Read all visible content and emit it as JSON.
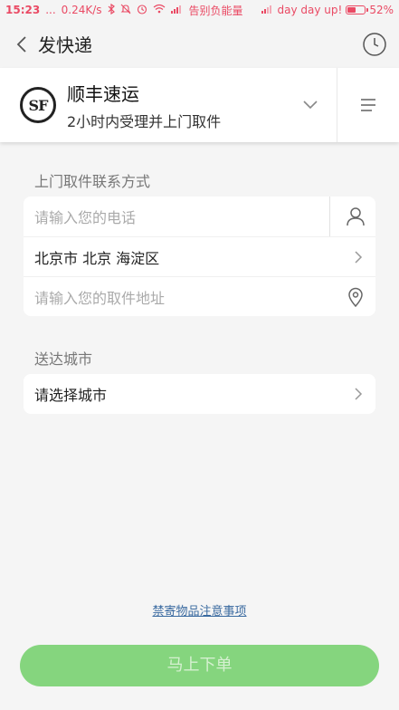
{
  "status_bar": {
    "time": "15:23",
    "dots": "...",
    "speed": "0.24K/s",
    "carrier1": "告别负能量",
    "carrier2": "day day up!",
    "battery": "52%",
    "battery_level": 0.52,
    "accent_color": "#ea4a64"
  },
  "header": {
    "title": "发快递",
    "back_icon": "chevron-left-icon",
    "history_icon": "clock-icon"
  },
  "courier": {
    "logo_text": "SF",
    "name": "顺丰速运",
    "subtitle": "2小时内受理并上门取件",
    "dropdown_icon": "chevron-down-icon",
    "menu_icon": "menu-icon"
  },
  "pickup": {
    "label": "上门取件联系方式",
    "phone_placeholder": "请输入您的电话",
    "region_value": "北京市 北京 海淀区",
    "address_placeholder": "请输入您的取件地址"
  },
  "destination": {
    "label": "送达城市",
    "city_value": "请选择城市"
  },
  "footer": {
    "notice_link": "禁寄物品注意事项",
    "submit_label": "马上下单",
    "submit_color": "#85d57e"
  }
}
